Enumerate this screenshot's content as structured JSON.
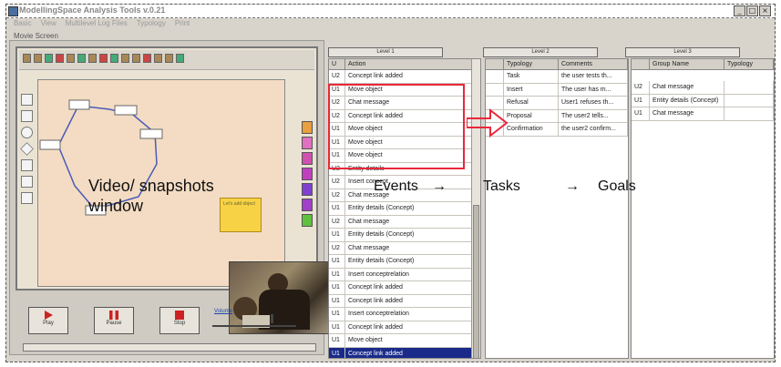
{
  "window": {
    "title": "ModellingSpace Analysis Tools v.0.21"
  },
  "menu": [
    "Basic",
    "View",
    "Multilevel Log Files",
    "Typology",
    "Print"
  ],
  "left_pane": {
    "title": "Movie Screen",
    "video_label_line1": "Video/ snapshots",
    "video_label_line2": "window",
    "note_text": "Let's add object",
    "buttons": {
      "play": "Play",
      "pause": "Pause",
      "stop": "Stop"
    },
    "volume_label": "Volume",
    "volume_level": 0.7
  },
  "level_tabs": {
    "level1": "Level 1",
    "level2": "Level 2",
    "level3": "Level 3"
  },
  "grid1": {
    "headers": [
      "U",
      "Action"
    ],
    "rows": [
      [
        "U2",
        "Concept link added"
      ],
      [
        "U1",
        "Move object"
      ],
      [
        "U2",
        "Chat message"
      ],
      [
        "U2",
        "Concept link added"
      ],
      [
        "U1",
        "Move object"
      ],
      [
        "U1",
        "Move object"
      ],
      [
        "U1",
        "Move object"
      ],
      [
        "U2",
        "Entity details"
      ],
      [
        "U2",
        "Insert concept"
      ],
      [
        "U2",
        "Chat message"
      ],
      [
        "U1",
        "Entity details (Concept)"
      ],
      [
        "U2",
        "Chat message"
      ],
      [
        "U1",
        "Entity details (Concept)"
      ],
      [
        "U2",
        "Chat message"
      ],
      [
        "U1",
        "Entity details (Concept)"
      ],
      [
        "U1",
        "Insert conceptrelation"
      ],
      [
        "U1",
        "Concept link added"
      ],
      [
        "U1",
        "Concept link added"
      ],
      [
        "U1",
        "Insert conceptrelation"
      ],
      [
        "U1",
        "Concept link added"
      ],
      [
        "U1",
        "Move object"
      ],
      [
        "U1",
        "Concept link added"
      ]
    ],
    "selected_index": 21
  },
  "grid2": {
    "headers": [
      "",
      "Typology",
      "Comments"
    ],
    "rows": [
      [
        "",
        "Task",
        "the user tests th..."
      ],
      [
        "",
        "Insert",
        "The user has m..."
      ],
      [
        "",
        "Refusal",
        "User1 refuses th..."
      ],
      [
        "",
        "Proposal",
        "The user2 tells..."
      ],
      [
        "",
        "Confirmation",
        "the user2 confirm..."
      ]
    ]
  },
  "grid3": {
    "headers": [
      "",
      "Group Name",
      "Typology"
    ],
    "rows": [
      [
        "U2",
        "Chat message",
        ""
      ],
      [
        "U1",
        "Entity details (Concept)",
        ""
      ],
      [
        "U1",
        "Chat message",
        ""
      ]
    ]
  },
  "flow": {
    "events": "Events",
    "tasks": "Tasks",
    "goals": "Goals",
    "arrow": "→"
  },
  "colors": {
    "selection": "#1a2a8a",
    "highlight": "#e8283a",
    "note": "#f7d244"
  }
}
